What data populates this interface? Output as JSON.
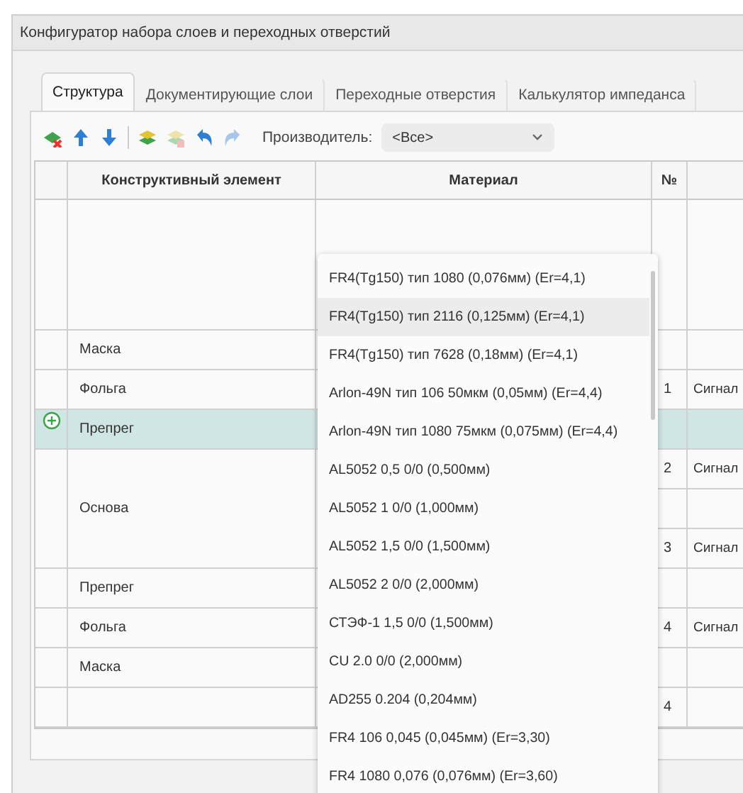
{
  "window": {
    "title": "Конфигуратор набора слоев и переходных отверстий"
  },
  "tabs": [
    {
      "label": "Структура",
      "selected": true
    },
    {
      "label": "Документирующие слои",
      "selected": false
    },
    {
      "label": "Переходные отверстия",
      "selected": false
    },
    {
      "label": "Калькулятор импеданса",
      "selected": false
    }
  ],
  "toolbar": [
    {
      "kind": "remove_layer",
      "disabled": false
    },
    {
      "kind": "up",
      "disabled": false
    },
    {
      "kind": "down",
      "disabled": false
    },
    {
      "kind": "separator"
    },
    {
      "kind": "add_layer",
      "disabled": false
    },
    {
      "kind": "copy_layer",
      "disabled": true
    },
    {
      "kind": "undo",
      "disabled": false
    },
    {
      "kind": "redo",
      "disabled": true
    }
  ],
  "manufacturer": {
    "label": "Производитель:",
    "value": "<Все>"
  },
  "table": {
    "columns": [
      "Конструктивный элемент",
      "Материал",
      "№"
    ],
    "rows": [
      {
        "kind": "top",
        "selected": false,
        "cells": [
          {}
        ]
      },
      {
        "kind": "layer",
        "element": "Маска",
        "selected": false,
        "cells": [
          {}
        ]
      },
      {
        "kind": "layer",
        "element": "Фольга",
        "selected": false,
        "cells": [
          {
            "number": "1",
            "type": "Сигнал"
          }
        ]
      },
      {
        "kind": "layer",
        "element": "Препрег",
        "selected": true,
        "insert_marker": true,
        "cells": [
          {}
        ]
      },
      {
        "kind": "layer",
        "element": "Основа",
        "selected": false,
        "cells": [
          {
            "number": "2",
            "type": "Сигнал"
          },
          {},
          {
            "number": "3",
            "type": "Сигнал"
          }
        ]
      },
      {
        "kind": "layer",
        "element": "Препрег",
        "selected": false,
        "cells": [
          {}
        ]
      },
      {
        "kind": "layer",
        "element": "Фольга",
        "selected": false,
        "cells": [
          {
            "number": "4",
            "type": "Сигнал"
          }
        ]
      },
      {
        "kind": "layer",
        "element": "Маска",
        "selected": false,
        "cells": [
          {}
        ]
      },
      {
        "kind": "layer",
        "selected": false,
        "cells": [
          {
            "number": "4"
          }
        ]
      }
    ]
  },
  "material_dropdown": {
    "options": [
      {
        "label": "FR4(Tg150) тип 1080 (0,076мм) (Er=4,1)",
        "selected": false
      },
      {
        "label": "FR4(Tg150) тип 2116 (0,125мм) (Er=4,1)",
        "selected": true
      },
      {
        "label": "FR4(Tg150) тип 7628 (0,18мм) (Er=4,1)",
        "selected": false
      },
      {
        "label": "Arlon-49N тип 106 50мкм (0,05мм) (Er=4,4)",
        "selected": false
      },
      {
        "label": "Arlon-49N тип 1080 75мкм (0,075мм) (Er=4,4)",
        "selected": false
      },
      {
        "label": "AL5052 0,5 0/0 (0,500мм)",
        "selected": false
      },
      {
        "label": "AL5052 1 0/0 (1,000мм)",
        "selected": false
      },
      {
        "label": "AL5052 1,5 0/0 (1,500мм)",
        "selected": false
      },
      {
        "label": "AL5052 2 0/0 (2,000мм)",
        "selected": false
      },
      {
        "label": "СТЭФ-1 1,5 0/0 (1,500мм)",
        "selected": false
      },
      {
        "label": "CU 2.0 0/0 (2,000мм)",
        "selected": false
      },
      {
        "label": "AD255 0.204 (0,204мм)",
        "selected": false
      },
      {
        "label": "FR4 106 0,045 (0,045мм) (Er=3,30)",
        "selected": false
      },
      {
        "label": "FR4 1080 0,076 (0,076мм) (Er=3,60)",
        "selected": false
      }
    ]
  }
}
